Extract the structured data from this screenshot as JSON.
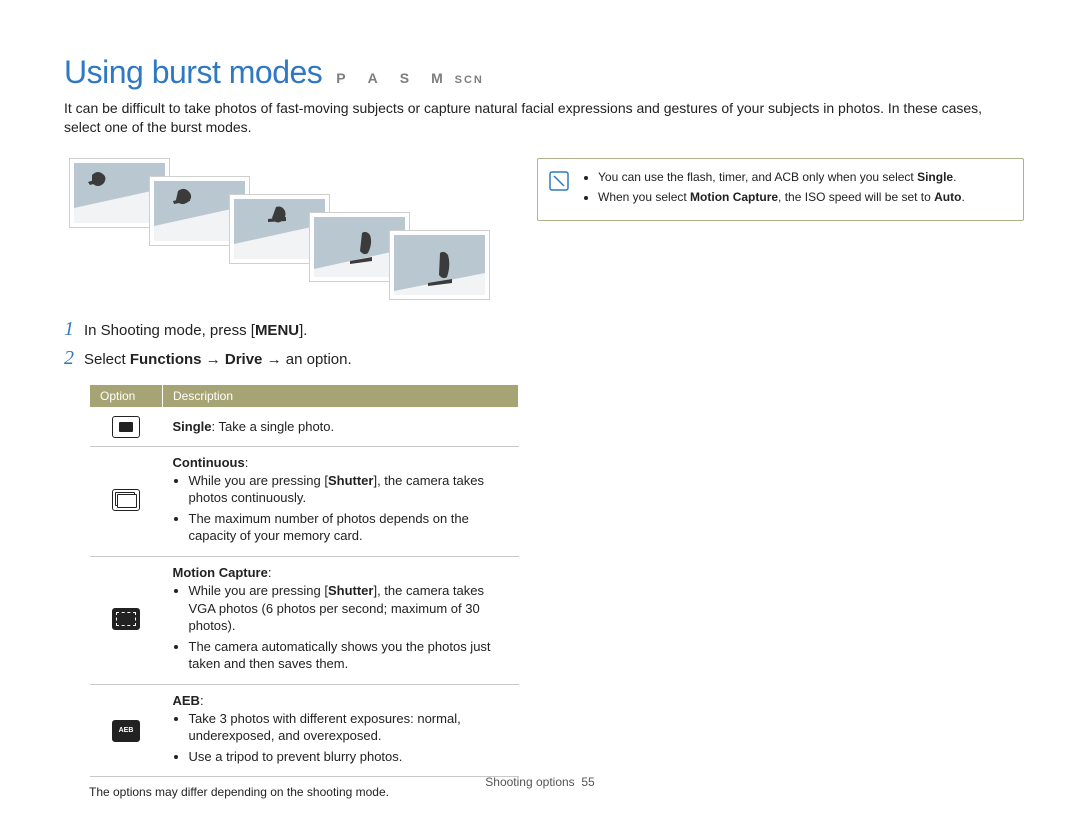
{
  "title": "Using burst modes",
  "title_modes_letters": "P A S M",
  "title_modes_scn": "SCN",
  "intro": "It can be difficult to take photos of fast-moving subjects or capture natural facial expressions and gestures of your subjects in photos. In these cases, select one of the burst modes.",
  "note": {
    "bullets": [
      {
        "pre": "You can use the flash, timer, and ACB only when you select ",
        "bold": "Single",
        "post": "."
      },
      {
        "pre": "When you select ",
        "bold": "Motion Capture",
        "post": ", the ISO speed will be set to ",
        "bold2": "Auto",
        "post2": "."
      }
    ]
  },
  "steps": [
    {
      "num": "1",
      "pre": "In Shooting mode, press [",
      "key": "MENU",
      "post": "]."
    },
    {
      "num": "2",
      "pre": "Select ",
      "b1": "Functions",
      "arrow1": " → ",
      "b2": "Drive",
      "arrow2": " → ",
      "post": "an option."
    }
  ],
  "table": {
    "headers": {
      "option": "Option",
      "description": "Description"
    },
    "rows": {
      "single": {
        "label": "Single",
        "label_desc": ": Take a single photo."
      },
      "continuous": {
        "label": "Continuous",
        "items": [
          {
            "pre": "While you are pressing [",
            "bold": "Shutter",
            "post": "], the camera takes photos continuously."
          },
          {
            "text": "The maximum number of photos depends on the capacity of your memory card."
          }
        ]
      },
      "motion": {
        "label": "Motion Capture",
        "items": [
          {
            "pre": "While you are pressing [",
            "bold": "Shutter",
            "post": "], the camera takes VGA photos (6 photos per second; maximum of 30 photos)."
          },
          {
            "text": "The camera automatically shows you the photos just taken and then saves them."
          }
        ]
      },
      "aeb": {
        "label": "AEB",
        "items": [
          {
            "text": "Take 3 photos with different exposures: normal, underexposed, and overexposed."
          },
          {
            "text": "Use a tripod to prevent blurry photos."
          }
        ]
      }
    }
  },
  "footnote": "The options may differ depending on the shooting mode.",
  "footer": {
    "section": "Shooting options",
    "page": "55"
  }
}
